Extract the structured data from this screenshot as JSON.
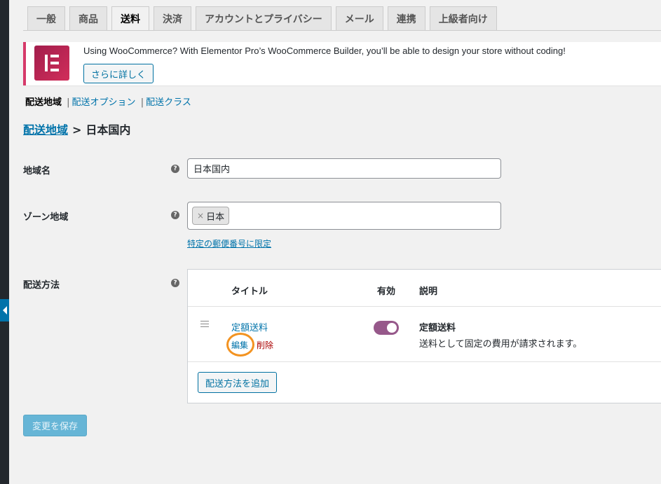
{
  "tabs": [
    "一般",
    "商品",
    "送料",
    "決済",
    "アカウントとプライバシー",
    "メール",
    "連携",
    "上級者向け"
  ],
  "active_tab": "送料",
  "notice": {
    "text": "Using WooCommerce? With Elementor Pro’s WooCommerce Builder, you’ll be able to design your store without coding!",
    "button": "さらに詳しく"
  },
  "subnav": {
    "current": "配送地域",
    "sep": "|",
    "options": "配送オプション",
    "classes": "配送クラス"
  },
  "breadcrumb": {
    "link": "配送地域",
    "separator": ">",
    "current": "日本国内"
  },
  "fields": {
    "zone_name": {
      "label": "地域名",
      "value": "日本国内"
    },
    "zone_regions": {
      "label": "ゾーン地域",
      "chip_remove": "×",
      "chip": "日本",
      "postcode_link": "特定の郵便番号に限定"
    },
    "methods_label": "配送方法"
  },
  "help_glyph": "?",
  "methods": {
    "headers": {
      "title": "タイトル",
      "enabled": "有効",
      "description": "説明"
    },
    "rows": [
      {
        "title": "定額送料",
        "edit": "編集",
        "delete": "削除",
        "enabled": true,
        "desc_title": "定額送料",
        "desc": "送料として固定の費用が請求されます。"
      }
    ],
    "add_button": "配送方法を追加"
  },
  "save_button": "変更を保存",
  "colors": {
    "accent": "#0073aa",
    "toggle_on": "#96588a",
    "delete": "#aa0000",
    "highlight_circle": "#f39321",
    "elementor": "#d12e5a"
  }
}
